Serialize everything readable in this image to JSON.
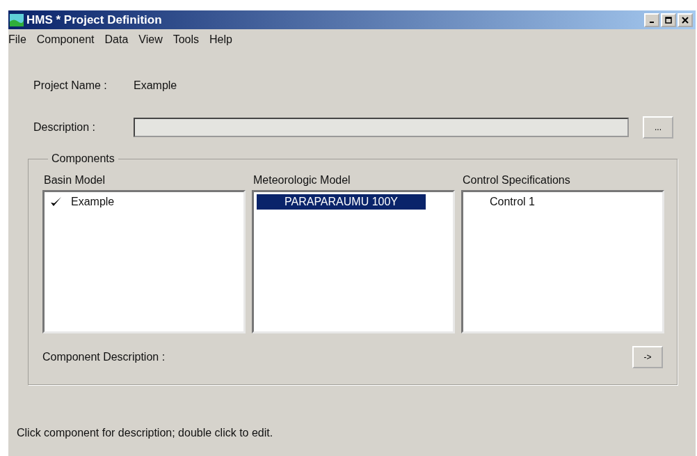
{
  "window": {
    "title": "HMS * Project Definition"
  },
  "menu": [
    "File",
    "Component",
    "Data",
    "View",
    "Tools",
    "Help"
  ],
  "project_name": {
    "label": "Project Name :",
    "value": "Example"
  },
  "description": {
    "label": "Description :",
    "button": "..."
  },
  "components": {
    "title": "Components",
    "lists": [
      {
        "heading": "Basin Model",
        "items": [
          {
            "label": "Example",
            "checked": true,
            "selected": false
          }
        ]
      },
      {
        "heading": "Meteorologic Model",
        "items": [
          {
            "label": "PARAPARAUMU 100Y",
            "checked": false,
            "selected": true
          }
        ]
      },
      {
        "heading": "Control Specifications",
        "items": [
          {
            "label": "Control 1",
            "checked": false,
            "selected": false
          }
        ]
      }
    ],
    "component_description": {
      "label": "Component Description :",
      "button": "->"
    }
  },
  "status_bar": "Click component for description; double click to edit."
}
